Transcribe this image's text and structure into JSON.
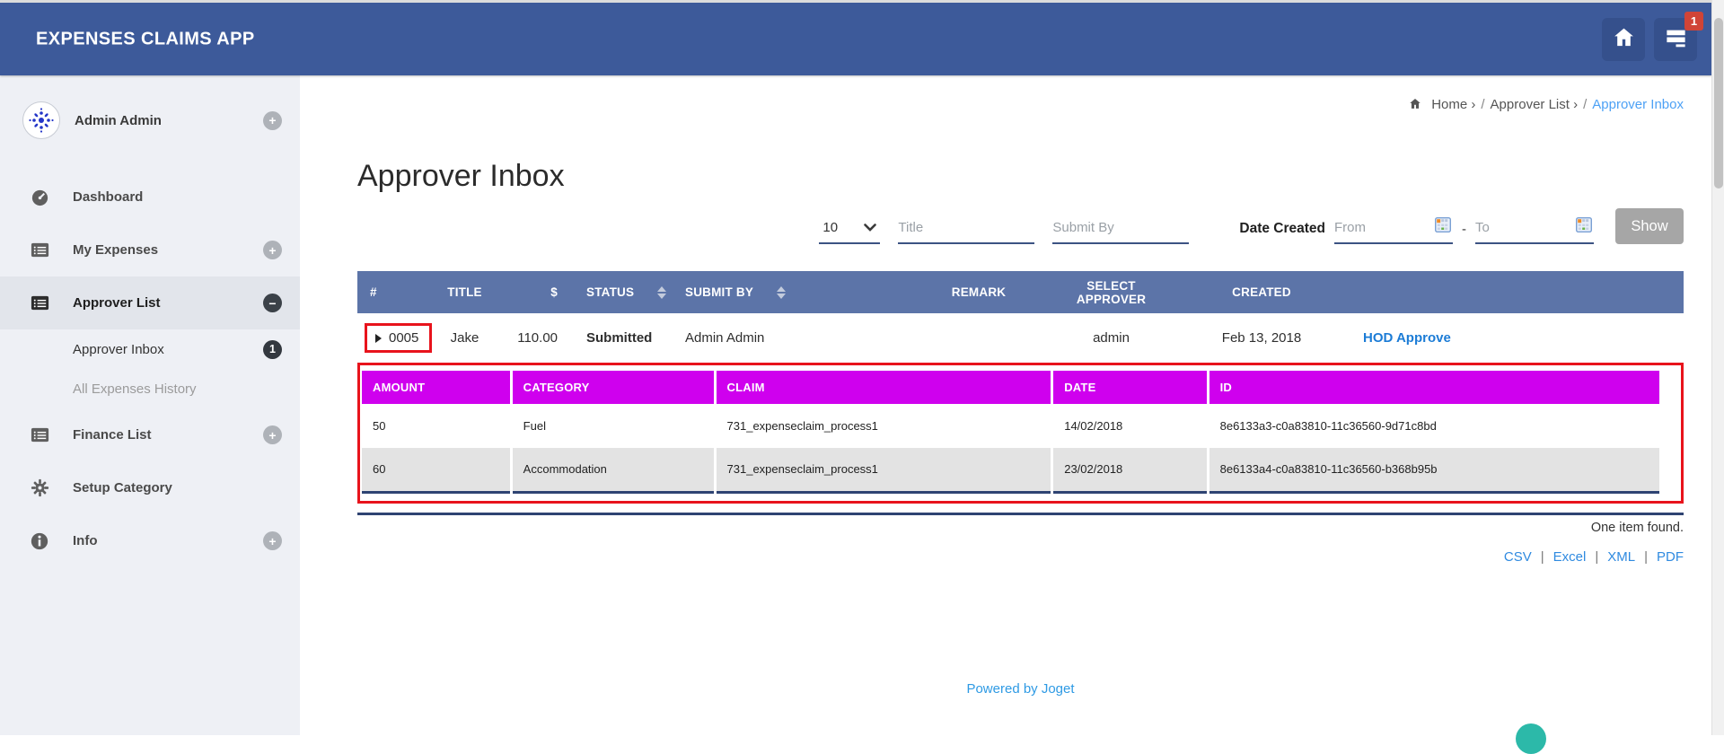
{
  "app": {
    "title": "EXPENSES CLAIMS APP",
    "notification_count": "1"
  },
  "sidebar": {
    "user": {
      "name": "Admin Admin",
      "expander": "+"
    },
    "items": [
      {
        "label": "Dashboard"
      },
      {
        "label": "My Expenses",
        "expander": "+"
      },
      {
        "label": "Approver List",
        "expander": "−",
        "active": true
      },
      {
        "label": "Approver Inbox",
        "badge": "1"
      },
      {
        "label": "All Expenses History"
      },
      {
        "label": "Finance List",
        "expander": "+"
      },
      {
        "label": "Setup Category"
      },
      {
        "label": "Info",
        "expander": "+"
      }
    ]
  },
  "breadcrumb": {
    "home": "Home",
    "parent": "Approver List",
    "current": "Approver Inbox",
    "caret": "›",
    "slash": "/"
  },
  "page": {
    "title": "Approver Inbox"
  },
  "filters": {
    "page_size": "10",
    "title_placeholder": "Title",
    "submit_by_placeholder": "Submit By",
    "date_label": "Date Created",
    "from_placeholder": "From",
    "to_placeholder": "To",
    "separator": "-",
    "show_label": "Show"
  },
  "inbox_table": {
    "columns": [
      "#",
      "TITLE",
      "$",
      "STATUS",
      "SUBMIT BY",
      "REMARK",
      "SELECT APPROVER",
      "CREATED"
    ],
    "row": {
      "id": "0005",
      "title": "Jake",
      "amount": "110.00",
      "status": "Submitted",
      "submit_by": "Admin Admin",
      "remark": "",
      "approver": "admin",
      "created": "Feb 13, 2018",
      "action": "HOD Approve"
    },
    "summary": "One item found."
  },
  "detail_table": {
    "columns": [
      "AMOUNT",
      "CATEGORY",
      "CLAIM",
      "DATE",
      "ID"
    ],
    "rows": [
      {
        "amount": "50",
        "category": "Fuel",
        "claim": "731_expenseclaim_process1",
        "date": "14/02/2018",
        "id": "8e6133a3-c0a83810-11c36560-9d71c8bd"
      },
      {
        "amount": "60",
        "category": "Accommodation",
        "claim": "731_expenseclaim_process1",
        "date": "23/02/2018",
        "id": "8e6133a4-c0a83810-11c36560-b368b95b"
      }
    ]
  },
  "export": {
    "csv": "CSV",
    "excel": "Excel",
    "xml": "XML",
    "pdf": "PDF",
    "divider": "|"
  },
  "footer": {
    "powered_by": "Powered by Joget"
  },
  "colors": {
    "navbar": "#3d5a9a",
    "table_header": "#5c74a8",
    "detail_header": "#cf00ee",
    "status_submitted": "#f5a01d",
    "annotation_red": "#e8131c",
    "link_blue": "#2e86de"
  }
}
